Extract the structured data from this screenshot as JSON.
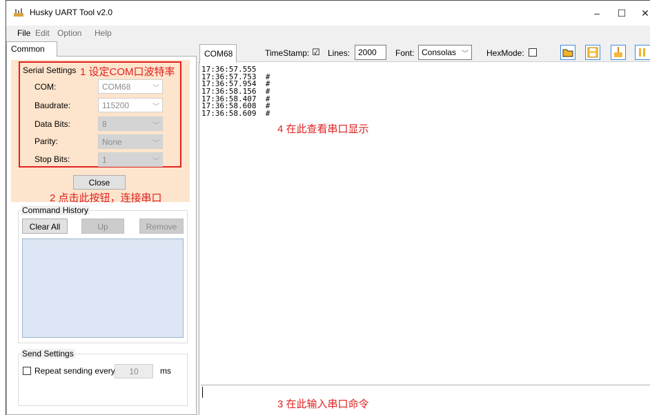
{
  "window": {
    "title": "Husky UART Tool v2.0",
    "minimize_icon": "minimize-icon",
    "maximize_icon": "maximize-icon",
    "close_icon": "close-icon"
  },
  "menu": [
    "File",
    "Edit",
    "Option",
    "Help"
  ],
  "left_tab": "Common",
  "serial_settings": {
    "title": "Serial Settings",
    "fields": [
      {
        "label": "COM:",
        "value": "COM68"
      },
      {
        "label": "Baudrate:",
        "value": "115200"
      },
      {
        "label": "Data Bits:",
        "value": "8"
      },
      {
        "label": "Parity:",
        "value": "None"
      },
      {
        "label": "Stop Bits:",
        "value": "1"
      }
    ],
    "close_button": "Close"
  },
  "command_history": {
    "title": "Command History",
    "clear_all": "Clear All",
    "up": "Up",
    "remove": "Remove"
  },
  "send_settings": {
    "title": "Send Settings",
    "repeat_label": "Repeat sending every",
    "interval": "10",
    "unit": "ms"
  },
  "right_tab": "COM68",
  "toolbar": {
    "timestamp_label": "TimeStamp:",
    "timestamp_checked": true,
    "lines_label": "Lines:",
    "lines_value": "2000",
    "font_label": "Font:",
    "font_value": "Consolas",
    "hexmode_label": "HexMode:",
    "hexmode_checked": false,
    "icons": [
      "open-folder-icon",
      "save-icon",
      "clear-icon",
      "pause-icon"
    ]
  },
  "log_lines": [
    "17:36:57.555",
    "17:36:57.753  #",
    "17:36:57.954  #",
    "17:36:58.156  #",
    "17:36:58.407  #",
    "17:36:58.608  #",
    "17:36:58.609  #"
  ],
  "annotations": {
    "a1": "1 设定COM口波特率",
    "a2": "2 点击此按钮，连接串口",
    "a3": "3 在此输入串口命令",
    "a4": "4 在此查看串口显示",
    "color": "#e02020"
  }
}
